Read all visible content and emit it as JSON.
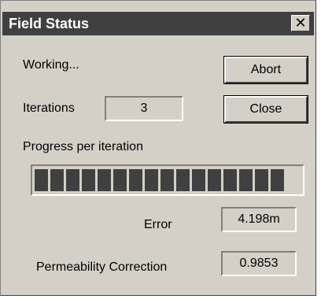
{
  "window": {
    "title": "Field Status",
    "close_icon": "close-icon"
  },
  "status": {
    "text": "Working..."
  },
  "iterations": {
    "label": "Iterations",
    "value": "3"
  },
  "progress": {
    "label": "Progress per iteration",
    "fraction": 1.0,
    "segments": 16
  },
  "error": {
    "label": "Error",
    "value": "4.198m"
  },
  "permeability": {
    "label": "Permeability Correction",
    "value": "0.9853"
  },
  "buttons": {
    "abort": "Abort",
    "close": "Close"
  },
  "colors": {
    "title_bar": "#404040",
    "dialog_bg": "#d4d0c8",
    "progress_fill": "#404040"
  }
}
